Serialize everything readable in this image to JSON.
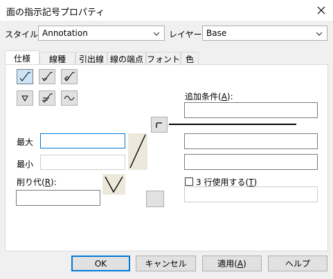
{
  "window": {
    "title": "面の指示記号プロパティ"
  },
  "top": {
    "style_label": "スタイル:",
    "style_value": "Annotation",
    "layer_label": "レイヤー:",
    "layer_value": "Base"
  },
  "tabs": [
    "仕様",
    "線種",
    "引出線",
    "線の端点",
    "フォント",
    "色"
  ],
  "spec": {
    "max_label": "最大",
    "min_label": "最小",
    "allowance_prefix": "削り代(",
    "allowance_key": "R",
    "allowance_suffix": "):",
    "add_cond_prefix": "追加条件(",
    "add_cond_key": "A",
    "add_cond_suffix": "):",
    "three_line_prefix": "3 行使用する(",
    "three_line_key": "T",
    "three_line_suffix": ")",
    "three_line_checked": false
  },
  "buttons": {
    "ok": "OK",
    "cancel": "キャンセル",
    "apply_prefix": "適用(",
    "apply_key": "A",
    "apply_suffix": ")",
    "help": "ヘルプ"
  }
}
